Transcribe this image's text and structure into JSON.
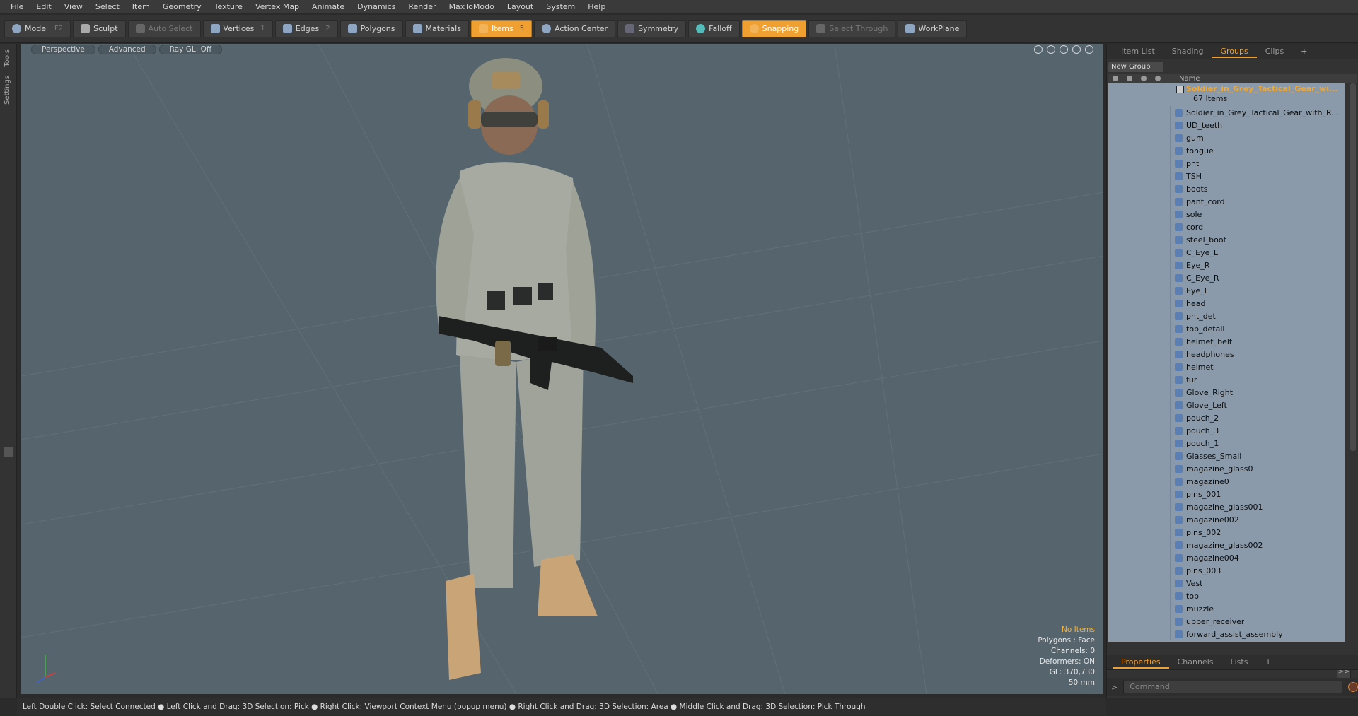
{
  "menu": [
    "File",
    "Edit",
    "View",
    "Select",
    "Item",
    "Geometry",
    "Texture",
    "Vertex Map",
    "Animate",
    "Dynamics",
    "Render",
    "MaxToModo",
    "Layout",
    "System",
    "Help"
  ],
  "toolbar": {
    "model": "Model",
    "model_key": "F2",
    "sculpt": "Sculpt",
    "auto_select": "Auto Select",
    "vertices": "Vertices",
    "vertices_key": "1",
    "edges": "Edges",
    "edges_key": "2",
    "polygons": "Polygons",
    "materials": "Materials",
    "items": "Items",
    "items_key": "5",
    "action_center": "Action Center",
    "symmetry": "Symmetry",
    "falloff": "Falloff",
    "snapping": "Snapping",
    "select_through": "Select Through",
    "workplane": "WorkPlane"
  },
  "left_strip": {
    "tools": "Tools",
    "settings": "Settings"
  },
  "viewport": {
    "perspective": "Perspective",
    "advanced": "Advanced",
    "raygl": "Ray GL: Off",
    "info": {
      "no_items": "No Items",
      "polygons": "Polygons : Face",
      "channels": "Channels: 0",
      "deformers": "Deformers: ON",
      "gl": "GL: 370,730",
      "focal": "50 mm"
    }
  },
  "right_panel": {
    "tabs": [
      "Item List",
      "Shading",
      "Groups",
      "Clips",
      "+"
    ],
    "active_tab": "Groups",
    "new_group": "New Group",
    "name_header": "Name",
    "group_name": "Soldier_in_Grey_Tactical_Gear_wi...",
    "group_count": "67 Items",
    "items": [
      "Soldier_in_Grey_Tactical_Gear_with_R...",
      "UD_teeth",
      "gum",
      "tongue",
      "pnt",
      "TSH",
      "boots",
      "pant_cord",
      "sole",
      "cord",
      "steel_boot",
      "C_Eye_L",
      "Eye_R",
      "C_Eye_R",
      "Eye_L",
      "head",
      "pnt_det",
      "top_detail",
      "helmet_belt",
      "headphones",
      "helmet",
      "fur",
      "Glove_Right",
      "Glove_Left",
      "pouch_2",
      "pouch_3",
      "pouch_1",
      "Glasses_Small",
      "magazine_glass0",
      "magazine0",
      "pins_001",
      "magazine_glass001",
      "magazine002",
      "pins_002",
      "magazine_glass002",
      "magazine004",
      "pins_003",
      "Vest",
      "top",
      "muzzle",
      "upper_receiver",
      "forward_assist_assembly"
    ],
    "bottom_tabs": [
      "Properties",
      "Channels",
      "Lists",
      "+"
    ],
    "bottom_active": "Properties",
    "command_placeholder": "Command",
    "expander": ">>"
  },
  "status_bar": "Left Double Click: Select Connected ● Left Click and Drag: 3D Selection: Pick ● Right Click: Viewport Context Menu (popup menu) ● Right Click and Drag: 3D Selection: Area ● Middle Click and Drag: 3D Selection: Pick Through",
  "colors": {
    "accent": "#f0a030",
    "viewport_bg": "#56646d",
    "list_bg": "#8a9aaa"
  }
}
